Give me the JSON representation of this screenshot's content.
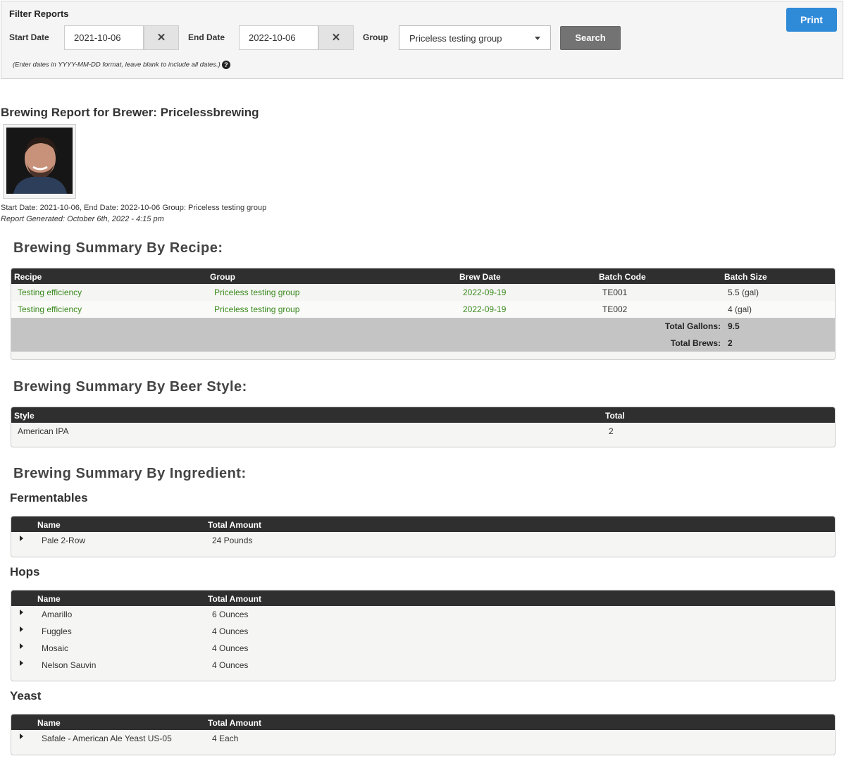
{
  "filter": {
    "title": "Filter Reports",
    "start_label": "Start Date",
    "start_value": "2021-10-06",
    "end_label": "End Date",
    "end_value": "2022-10-06",
    "group_label": "Group",
    "group_value": "Priceless testing group",
    "search_label": "Search",
    "print_label": "Print",
    "hint": "(Enter dates in YYYY-MM-DD format, leave blank to include all dates.)",
    "clear_glyph": "✕",
    "help_glyph": "?"
  },
  "report": {
    "title": "Brewing Report for Brewer: Pricelessbrewing",
    "meta_line": "Start Date: 2021-10-06, End Date: 2022-10-06 Group: Priceless testing group",
    "generated": "Report Generated: October 6th, 2022 - 4:15 pm"
  },
  "by_recipe": {
    "heading": "Brewing Summary By Recipe:",
    "columns": [
      "Recipe",
      "Group",
      "Brew Date",
      "Batch Code",
      "Batch Size"
    ],
    "rows": [
      {
        "recipe": "Testing efficiency",
        "group": "Priceless testing group",
        "date": "2022-09-19",
        "code": "TE001",
        "size": "5.5 (gal)"
      },
      {
        "recipe": "Testing efficiency",
        "group": "Priceless testing group",
        "date": "2022-09-19",
        "code": "TE002",
        "size": "4 (gal)"
      }
    ],
    "total_gallons_label": "Total Gallons:",
    "total_gallons": "9.5",
    "total_brews_label": "Total Brews:",
    "total_brews": "2"
  },
  "by_style": {
    "heading": "Brewing Summary By Beer Style:",
    "columns": [
      "Style",
      "Total"
    ],
    "rows": [
      {
        "style": "American IPA",
        "total": "2"
      }
    ]
  },
  "by_ingredient": {
    "heading": "Brewing Summary By Ingredient:",
    "columns": [
      "Name",
      "Total Amount"
    ],
    "fermentables": {
      "heading": "Fermentables",
      "rows": [
        {
          "name": "Pale 2-Row",
          "amount": "24 Pounds"
        }
      ]
    },
    "hops": {
      "heading": "Hops",
      "rows": [
        {
          "name": "Amarillo",
          "amount": "6 Ounces"
        },
        {
          "name": "Fuggles",
          "amount": "4 Ounces"
        },
        {
          "name": "Mosaic",
          "amount": "4 Ounces"
        },
        {
          "name": "Nelson Sauvin",
          "amount": "4 Ounces"
        }
      ]
    },
    "yeast": {
      "heading": "Yeast",
      "rows": [
        {
          "name": "Safale - American Ale Yeast US-05",
          "amount": "4 Each"
        }
      ]
    }
  },
  "colors": {
    "link_green": "#3a8a1e",
    "print_blue": "#2f8ad8",
    "header_dark": "#2f2f2f"
  }
}
